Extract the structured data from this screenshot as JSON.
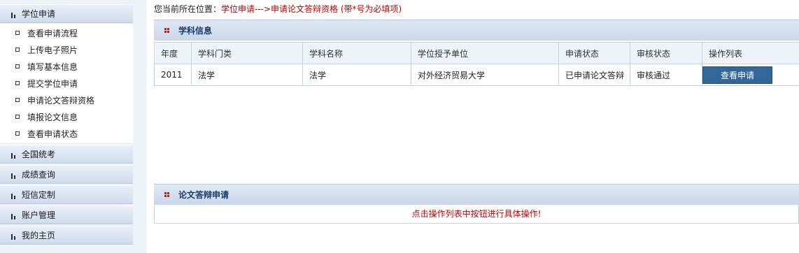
{
  "sidebar": {
    "active_menu": "学位申请",
    "sub_items": [
      "查看申请流程",
      "上传电子照片",
      "填写基本信息",
      "提交学位申请",
      "申请论文答辩资格",
      "填报论文信息",
      "查看申请状态"
    ],
    "menus": [
      "全国统考",
      "成绩查询",
      "短信定制",
      "账户管理",
      "我的主页"
    ]
  },
  "breadcrumb": {
    "prefix": "您当前所在位置：",
    "path": "学位申请--->申请论文答辩资格 (带*号为必填项)"
  },
  "subject_section": {
    "title": "学科信息",
    "columns": [
      "年度",
      "学科门类",
      "学科名称",
      "学位授予单位",
      "申请状态",
      "审核状态",
      "操作列表"
    ],
    "rows": [
      {
        "year": "2011",
        "category": "法学",
        "name": "法学",
        "unit": "对外经济贸易大学",
        "apply_status": "已申请论文答辩",
        "review_status": "审核通过",
        "action": "查看申请"
      }
    ]
  },
  "defense_section": {
    "title": "论文答辩申请",
    "hint": "点击操作列表中按钮进行具体操作!"
  },
  "colors": {
    "accent": "#336699",
    "warning": "#c00000",
    "sidebar_bg": "#eef2f9"
  }
}
